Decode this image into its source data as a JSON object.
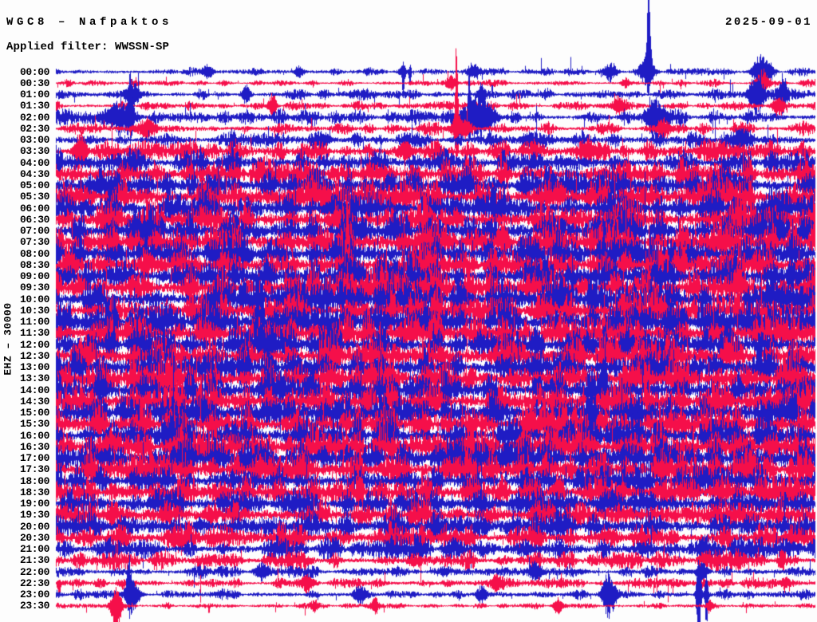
{
  "header": {
    "station_line": "WGC8 – Nafpaktos",
    "filter_line": "Applied filter: WWSSN-SP",
    "date": "2025-09-01"
  },
  "y_axis": {
    "label": "EHZ – 30000"
  },
  "colors": {
    "trace_blue": "#1f1cc4",
    "trace_red": "#f50f4a",
    "text": "#000000",
    "background": "#fdfdfd"
  },
  "chart_data": {
    "type": "seismogram-helicorder",
    "station": "WGC8",
    "location_name": "Nafpaktos",
    "channel": "EHZ",
    "amplitude_scale": 30000,
    "filter": "WWSSN-SP",
    "date": "2025-09-01",
    "rows_per_day": 48,
    "minutes_per_row": 30,
    "row_color_rule": "alternating blue (:00) and red (:30)",
    "legend_position": "none",
    "grid": false,
    "rows": [
      {
        "t": "00:00",
        "color": "blue",
        "amp": 3.0,
        "events": [
          {
            "x": 0.457,
            "w": 2,
            "a": 26,
            "up": 0.35,
            "dn": 1
          },
          {
            "x": 0.466,
            "w": 1.5,
            "a": 20,
            "up": 0.3,
            "dn": 1
          },
          {
            "x": 0.78,
            "w": 2.5,
            "a": 88,
            "up": 1,
            "dn": 0.22
          },
          {
            "x": 0.778,
            "w": 9,
            "a": 15
          },
          {
            "x": 0.929,
            "w": 10,
            "a": 20
          },
          {
            "x": 0.2,
            "w": 7,
            "a": 7
          },
          {
            "x": 0.32,
            "w": 6,
            "a": 6
          },
          {
            "x": 0.55,
            "w": 8,
            "a": 7
          },
          {
            "x": 0.73,
            "w": 7,
            "a": 8
          }
        ]
      },
      {
        "t": "00:30",
        "color": "red",
        "amp": 2.6,
        "events": [
          {
            "x": 0.52,
            "w": 6,
            "a": 8
          },
          {
            "x": 0.75,
            "w": 5,
            "a": 6
          },
          {
            "x": 0.93,
            "w": 8,
            "a": 13
          }
        ]
      },
      {
        "t": "01:00",
        "color": "blue",
        "amp": 4.0,
        "events": [
          {
            "x": 0.922,
            "w": 9,
            "a": 26
          },
          {
            "x": 0.956,
            "w": 6,
            "a": 17
          },
          {
            "x": 0.1,
            "w": 8,
            "a": 10
          },
          {
            "x": 0.56,
            "w": 4,
            "a": 12
          },
          {
            "x": 0.25,
            "w": 5,
            "a": 8
          }
        ]
      },
      {
        "t": "01:30",
        "color": "red",
        "amp": 3.2,
        "events": [
          {
            "x": 0.285,
            "w": 5,
            "a": 13
          },
          {
            "x": 0.74,
            "w": 6,
            "a": 9
          },
          {
            "x": 0.95,
            "w": 7,
            "a": 10
          }
        ]
      },
      {
        "t": "02:00",
        "color": "blue",
        "amp": 6.0,
        "events": [
          {
            "x": 0.544,
            "w": 2,
            "a": 55,
            "up": 1,
            "dn": 0.4
          },
          {
            "x": 0.556,
            "w": 18,
            "a": 20
          },
          {
            "x": 0.098,
            "w": 3,
            "a": 40,
            "up": 1,
            "dn": 0.5
          },
          {
            "x": 0.084,
            "w": 16,
            "a": 15
          },
          {
            "x": 0.788,
            "w": 10,
            "a": 17
          }
        ]
      },
      {
        "t": "02:30",
        "color": "red",
        "amp": 5.0,
        "events": [
          {
            "x": 0.527,
            "w": 2,
            "a": 85,
            "up": 1,
            "dn": 0.45
          },
          {
            "x": 0.53,
            "w": 10,
            "a": 13
          },
          {
            "x": 0.12,
            "w": 10,
            "a": 11
          },
          {
            "x": 0.8,
            "w": 8,
            "a": 9
          }
        ]
      },
      {
        "t": "03:00",
        "color": "blue",
        "amp": 6.5,
        "events": [
          {
            "x": 0.35,
            "w": 10,
            "a": 8
          },
          {
            "x": 0.62,
            "w": 8,
            "a": 8
          },
          {
            "x": 0.9,
            "w": 8,
            "a": 10
          }
        ]
      },
      {
        "t": "03:30",
        "color": "red",
        "amp": 9.0,
        "events": [
          {
            "x": 0.032,
            "w": 8,
            "a": 17
          },
          {
            "x": 0.46,
            "w": 10,
            "a": 9
          },
          {
            "x": 0.7,
            "w": 10,
            "a": 9
          }
        ]
      },
      {
        "t": "04:00",
        "color": "blue",
        "amp": 11.0,
        "events": []
      },
      {
        "t": "04:30",
        "color": "red",
        "amp": 13.0,
        "events": []
      },
      {
        "t": "05:00",
        "color": "blue",
        "amp": 15.0,
        "events": []
      },
      {
        "t": "05:30",
        "color": "red",
        "amp": 15.0,
        "events": []
      },
      {
        "t": "06:00",
        "color": "blue",
        "amp": 15.0,
        "events": []
      },
      {
        "t": "06:30",
        "color": "red",
        "amp": 16.0,
        "events": []
      },
      {
        "t": "07:00",
        "color": "blue",
        "amp": 17.0,
        "events": []
      },
      {
        "t": "07:30",
        "color": "red",
        "amp": 17.0,
        "events": []
      },
      {
        "t": "08:00",
        "color": "blue",
        "amp": 16.0,
        "events": []
      },
      {
        "t": "08:30",
        "color": "red",
        "amp": 16.0,
        "events": []
      },
      {
        "t": "09:00",
        "color": "blue",
        "amp": 16.0,
        "events": []
      },
      {
        "t": "09:30",
        "color": "red",
        "amp": 16.0,
        "events": []
      },
      {
        "t": "10:00",
        "color": "blue",
        "amp": 17.0,
        "events": []
      },
      {
        "t": "10:30",
        "color": "red",
        "amp": 16.0,
        "events": []
      },
      {
        "t": "11:00",
        "color": "blue",
        "amp": 17.0,
        "events": [
          {
            "x": 0.265,
            "w": 2.5,
            "a": 48,
            "up": 1,
            "dn": 0.5
          },
          {
            "x": 0.272,
            "w": 2,
            "a": 34,
            "up": 1,
            "dn": 0.4
          }
        ]
      },
      {
        "t": "11:30",
        "color": "red",
        "amp": 16.0,
        "events": []
      },
      {
        "t": "12:00",
        "color": "blue",
        "amp": 16.0,
        "events": [
          {
            "x": 0.722,
            "w": 2.5,
            "a": 42,
            "up": 0.7,
            "dn": 1
          }
        ]
      },
      {
        "t": "12:30",
        "color": "red",
        "amp": 16.0,
        "events": []
      },
      {
        "t": "13:00",
        "color": "blue",
        "amp": 16.0,
        "events": []
      },
      {
        "t": "13:30",
        "color": "red",
        "amp": 15.0,
        "events": []
      },
      {
        "t": "14:00",
        "color": "blue",
        "amp": 16.0,
        "events": [
          {
            "x": 0.722,
            "w": 2.5,
            "a": 40,
            "up": 1,
            "dn": 0.8
          }
        ]
      },
      {
        "t": "14:30",
        "color": "red",
        "amp": 15.0,
        "events": []
      },
      {
        "t": "15:00",
        "color": "blue",
        "amp": 16.0,
        "events": []
      },
      {
        "t": "15:30",
        "color": "red",
        "amp": 16.0,
        "events": []
      },
      {
        "t": "16:00",
        "color": "blue",
        "amp": 16.0,
        "events": []
      },
      {
        "t": "16:30",
        "color": "red",
        "amp": 15.0,
        "events": []
      },
      {
        "t": "17:00",
        "color": "blue",
        "amp": 15.0,
        "events": []
      },
      {
        "t": "17:30",
        "color": "red",
        "amp": 15.0,
        "events": []
      },
      {
        "t": "18:00",
        "color": "blue",
        "amp": 14.0,
        "events": []
      },
      {
        "t": "18:30",
        "color": "red",
        "amp": 13.0,
        "events": []
      },
      {
        "t": "19:00",
        "color": "blue",
        "amp": 12.0,
        "events": []
      },
      {
        "t": "19:30",
        "color": "red",
        "amp": 12.0,
        "events": []
      },
      {
        "t": "20:00",
        "color": "blue",
        "amp": 12.0,
        "events": []
      },
      {
        "t": "20:30",
        "color": "red",
        "amp": 11.0,
        "events": []
      },
      {
        "t": "21:00",
        "color": "blue",
        "amp": 9.5,
        "events": []
      },
      {
        "t": "21:30",
        "color": "red",
        "amp": 7.5,
        "events": []
      },
      {
        "t": "22:00",
        "color": "blue",
        "amp": 5.0,
        "events": [
          {
            "x": 0.27,
            "w": 8,
            "a": 8
          },
          {
            "x": 0.63,
            "w": 7,
            "a": 7
          },
          {
            "x": 0.85,
            "w": 6,
            "a": 8
          }
        ]
      },
      {
        "t": "22:30",
        "color": "red",
        "amp": 4.0,
        "events": [
          {
            "x": 0.004,
            "w": 2,
            "a": 22,
            "up": 0.2,
            "dn": 1
          },
          {
            "x": 0.33,
            "w": 7,
            "a": 8
          },
          {
            "x": 0.58,
            "w": 6,
            "a": 7
          },
          {
            "x": 0.96,
            "w": 5,
            "a": 6
          }
        ]
      },
      {
        "t": "23:00",
        "color": "blue",
        "amp": 4.0,
        "events": [
          {
            "x": 0.728,
            "w": 8,
            "a": 22
          },
          {
            "x": 0.846,
            "w": 3,
            "a": 55,
            "up": 0.75,
            "dn": 1
          },
          {
            "x": 0.856,
            "w": 2,
            "a": 40,
            "up": 0.6,
            "dn": 1
          },
          {
            "x": 0.096,
            "w": 3,
            "a": 35,
            "up": 1,
            "dn": 0.4
          },
          {
            "x": 0.1,
            "w": 10,
            "a": 12
          },
          {
            "x": 0.4,
            "w": 8,
            "a": 8
          },
          {
            "x": 0.56,
            "w": 6,
            "a": 8
          }
        ]
      },
      {
        "t": "23:30",
        "color": "red",
        "amp": 2.4,
        "events": [
          {
            "x": 0.079,
            "w": 6,
            "a": 30,
            "up": 0.55,
            "dn": 1
          },
          {
            "x": 0.42,
            "w": 5,
            "a": 8
          },
          {
            "x": 0.66,
            "w": 5,
            "a": 8
          },
          {
            "x": 0.86,
            "w": 3,
            "a": 6
          },
          {
            "x": 0.34,
            "w": 4,
            "a": 6
          }
        ]
      }
    ]
  }
}
